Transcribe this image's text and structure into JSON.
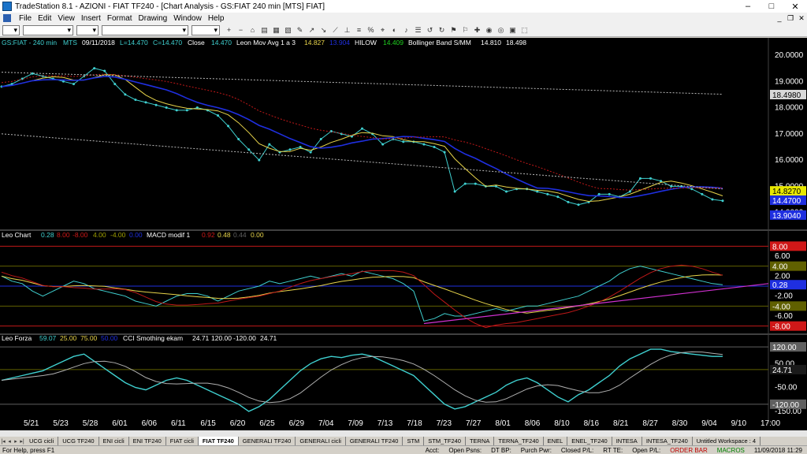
{
  "window": {
    "title": "TradeStation 8.1 - AZIONI - FIAT TF240 - [Chart Analysis - GS:FIAT  240 min  [MTS] FIAT]",
    "minimize": "–",
    "maximize": "□",
    "close": "✕"
  },
  "menu": {
    "items": [
      "File",
      "Edit",
      "View",
      "Insert",
      "Format",
      "Drawing",
      "Window",
      "Help"
    ]
  },
  "toolbar": {
    "selects": [
      "",
      "",
      "",
      "",
      ""
    ],
    "icons": [
      "+",
      "−",
      "⌂",
      "▤",
      "▦",
      "▧",
      "✎",
      "↗",
      "↘",
      "⟋",
      "⊥",
      "≡",
      "%",
      "⌖",
      "◐",
      "♪",
      "☰",
      "↺",
      "↻",
      "⚑",
      "⚐",
      "✚",
      "◉",
      "◎",
      "▣",
      "⬚"
    ]
  },
  "chart": {
    "colors": {
      "price": "#3fd0d0",
      "ma_yellow": "#e8d44a",
      "blue": "#1f2fe0",
      "red_dots": "#c01818",
      "gray_dots": "#b8b8b8",
      "magenta": "#d030d0"
    },
    "price_header": {
      "symbol": "GS:FIAT - 240 min",
      "mts": "MTS",
      "date": "09/11/2018",
      "low": "L=14.470",
      "close": "C=14.470",
      "close_label": "Close",
      "close_value": "14.470",
      "mov_avg_label": "Leon Mov Avg 1 a 3",
      "mov_avg_value": "14.827",
      "mov_avg_value2": "13.904",
      "hilow_label": "HILOW",
      "hilow_value": "14.409",
      "bollinger_label": "Bollinger Band S/MM",
      "bollinger_value1": "14.810",
      "bollinger_value2": "18.498"
    },
    "price_axis": {
      "ticks": [
        "20.0000",
        "19.0000",
        "18.0000",
        "17.0000",
        "16.0000",
        "15.0000",
        "14.0000"
      ],
      "markers": [
        {
          "label": "18.4980",
          "bg": "#d8d8d8",
          "fg": "#000000"
        },
        {
          "label": "14.8270",
          "bg": "#e8e800",
          "fg": "#000000"
        },
        {
          "label": "14.4700",
          "bg": "#1f2fe0",
          "fg": "#ffffff"
        },
        {
          "label": "13.9040",
          "bg": "#1f2fe0",
          "fg": "#ffffff"
        }
      ]
    },
    "leo_header": {
      "label": "Leo Chart",
      "v1": "0.28",
      "v2": "8.00",
      "v3": "-8.00",
      "v4": "4.00",
      "v5": "-4.00",
      "v6": "0.00",
      "macd_label": "MACD modif 1",
      "macd1": "0.92",
      "macd2": "0.48",
      "macd3": "0.44",
      "macd4": "0.00"
    },
    "leo_axis": {
      "ticks": [
        "6.00",
        "2.00",
        "-2.00",
        "-6.00"
      ],
      "markers": [
        {
          "label": "8.00",
          "bg": "#d01818",
          "fg": "#ffffff"
        },
        {
          "label": "4.00",
          "bg": "#606000",
          "fg": "#ffffff"
        },
        {
          "label": "0.28",
          "bg": "#1f2fe0",
          "fg": "#ffffff"
        },
        {
          "label": "-4.00",
          "bg": "#606000",
          "fg": "#ffffff"
        },
        {
          "label": "-8.00",
          "bg": "#d01818",
          "fg": "#ffffff"
        }
      ]
    },
    "forza_header": {
      "label": "Leo Forza",
      "v1": "59.07",
      "v2": "25.00",
      "v3": "75.00",
      "v4": "50.00",
      "cci_label": "CCI Smothing ekam",
      "cci1": "24.71",
      "cci2": "120.00",
      "cci3": "-120.00",
      "cci4": "24.71"
    },
    "forza_axis": {
      "ticks": [
        "50.00",
        "-50.00",
        "-150.00"
      ],
      "markers": [
        {
          "label": "120.00",
          "bg": "#606060",
          "fg": "#ffffff"
        },
        {
          "label": "24.71",
          "bg": "#1a1a1a",
          "fg": "#ffffff"
        },
        {
          "label": "-120.00",
          "bg": "#606060",
          "fg": "#ffffff"
        }
      ]
    },
    "date_axis": [
      "5/21",
      "5/23",
      "5/28",
      "6/01",
      "6/06",
      "6/11",
      "6/15",
      "6/20",
      "6/25",
      "6/29",
      "7/04",
      "7/09",
      "7/13",
      "7/18",
      "7/23",
      "7/27",
      "8/01",
      "8/06",
      "8/10",
      "8/16",
      "8/21",
      "8/27",
      "8/30",
      "9/04",
      "9/10",
      "17:00"
    ]
  },
  "tabs": [
    "UCG cicli",
    "UCG TF240",
    "ENI cicli",
    "ENI TF240",
    "FIAT cicli",
    "FIAT TF240",
    "GENERALI TF240",
    "GENERALI cicli",
    "GENERALI TF240",
    "STM",
    "STM_TF240",
    "TERNA",
    "TERNA_TF240",
    "ENEL",
    "ENEL_TF240",
    "INTESA",
    "INTESA_TF240",
    "Untitled Workspace : 4"
  ],
  "active_tab": "FIAT TF240",
  "status": {
    "help": "For Help, press F1",
    "acct": "Acct:",
    "open_psns": "Open Psns:",
    "dt_bp": "DT BP:",
    "purch_pwr": "Purch Pwr:",
    "closed_pl": "Closed P/L:",
    "rt_te": "RT TE:",
    "open_pl": "Open P/L:",
    "order_bar": "ORDER BAR",
    "macros": "MACROS",
    "datetime": "11/09/2018 11:29"
  }
}
